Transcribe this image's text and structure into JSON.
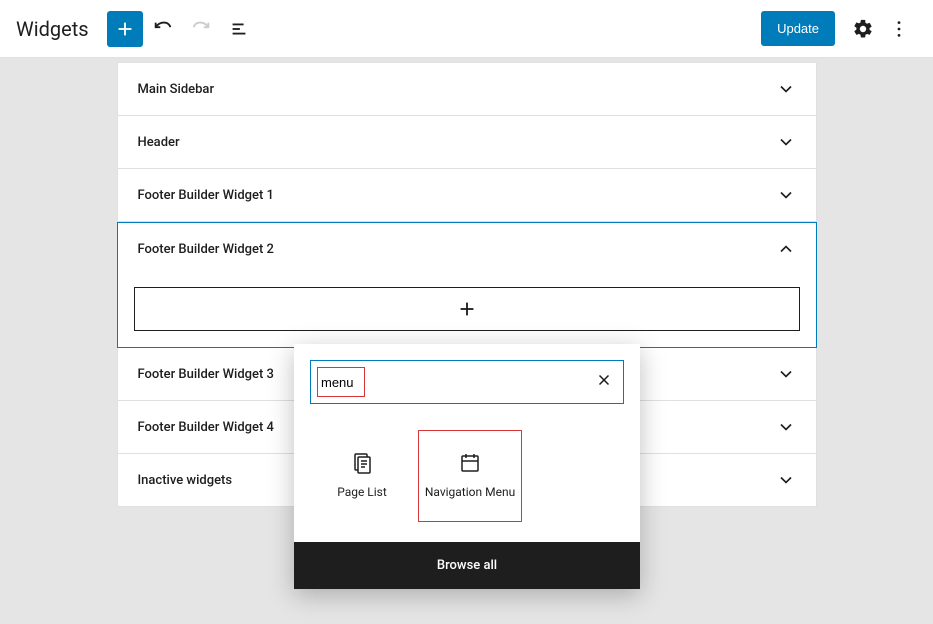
{
  "header": {
    "title": "Widgets",
    "update_label": "Update"
  },
  "areas": [
    {
      "title": "Main Sidebar"
    },
    {
      "title": "Header"
    },
    {
      "title": "Footer Builder Widget 1"
    },
    {
      "title": "Footer Builder Widget 2"
    },
    {
      "title": "Footer Builder Widget 3"
    },
    {
      "title": "Footer Builder Widget 4"
    },
    {
      "title": "Inactive widgets"
    }
  ],
  "inserter": {
    "search_value": "menu",
    "blocks": [
      {
        "label": "Page List",
        "icon": "page-list"
      },
      {
        "label": "Navigation Menu",
        "icon": "nav-menu"
      }
    ],
    "browse_all": "Browse all"
  }
}
